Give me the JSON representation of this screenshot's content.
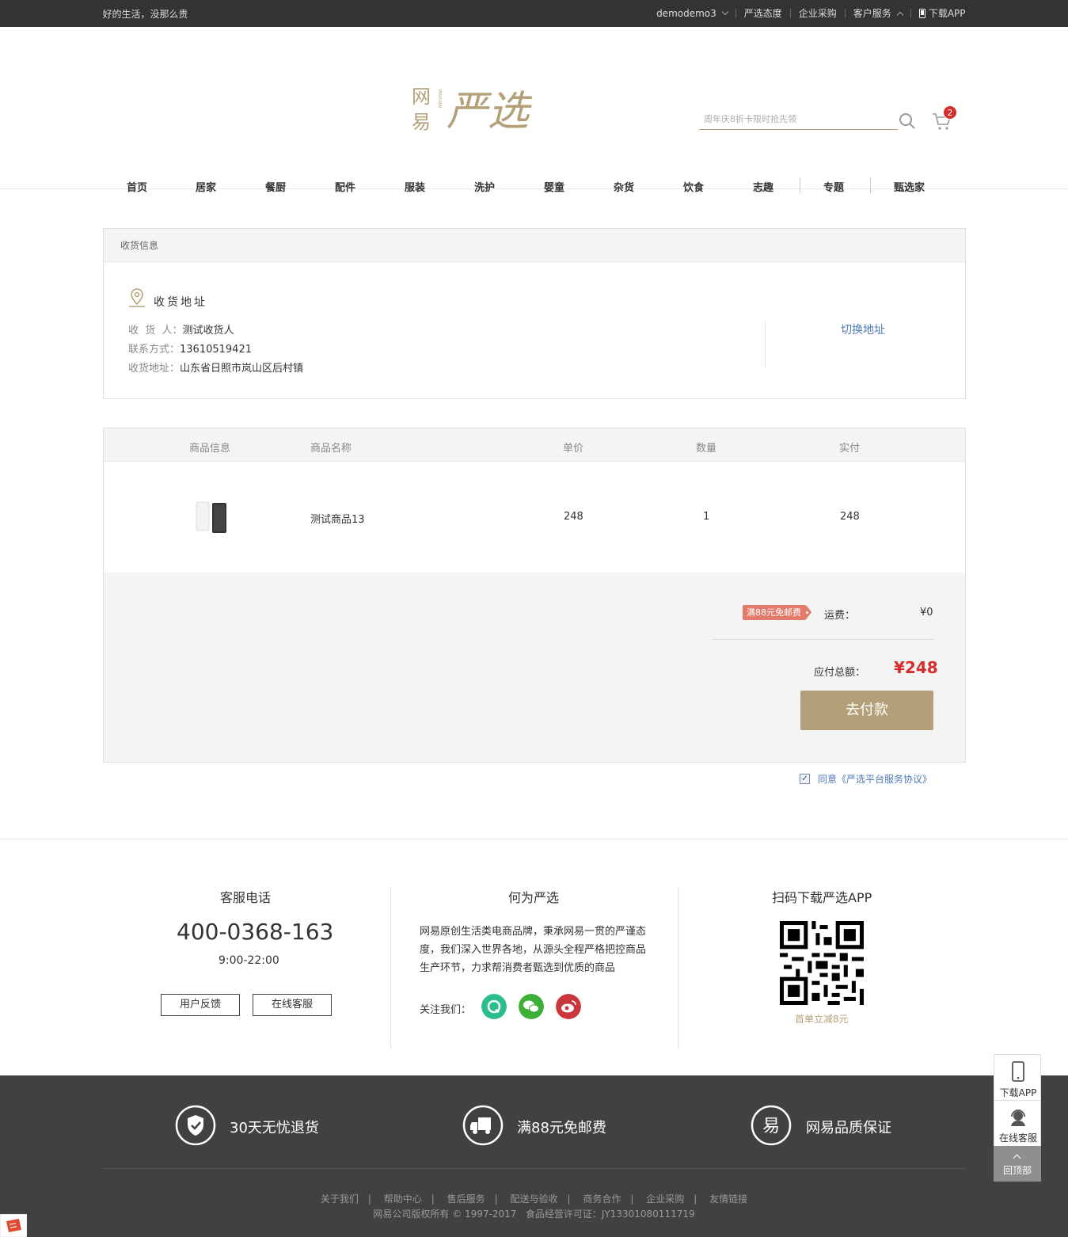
{
  "topbar": {
    "slogan": "好的生活，没那么贵",
    "user": "demodemo3",
    "links": [
      "严选态度",
      "企业采购",
      "客户服务"
    ],
    "app": "下载APP"
  },
  "header": {
    "search_placeholder": "周年庆8折卡限时抢先领",
    "cart_count": "2",
    "nav": [
      "首页",
      "居家",
      "餐厨",
      "配件",
      "服装",
      "洗护",
      "婴童",
      "杂货",
      "饮食",
      "志趣",
      "专题",
      "甄选家"
    ]
  },
  "address": {
    "panel_title": "收货信息",
    "section_title": "收货地址",
    "receiver_label": "收  货  人：",
    "receiver": "测试收货人",
    "phone_label": "联系方式：",
    "phone": "13610519421",
    "addr_label": "收货地址：",
    "addr": "山东省日照市岚山区后村镇",
    "switch": "切换地址"
  },
  "order": {
    "headers": [
      "商品信息",
      "商品名称",
      "单价",
      "数量",
      "实付"
    ],
    "item": {
      "name": "测试商品13",
      "price": "248",
      "qty": "1",
      "paid": "248"
    }
  },
  "summary": {
    "promo_tag": "满88元免邮费",
    "shipping_label": "运费：",
    "shipping": "¥0",
    "total_label": "应付总额：",
    "total": "¥248",
    "pay_button": "去付款",
    "agree": "同意《严选平台服务协议》"
  },
  "footer": {
    "service_title": "客服电话",
    "phone": "400-0368-163",
    "hours": "9:00-22:00",
    "feedback": "用户反馈",
    "online": "在线客服",
    "about_title": "何为严选",
    "about_text": [
      "网易原创生活类电商品牌，秉承网易一贯的严谨态",
      "度，我们深入世界各地，从源头全程严格把控商品",
      "生产环节，力求帮消费者甄选到优质的商品"
    ],
    "follow": "关注我们：",
    "qr_title": "扫码下载严选APP",
    "qr_note": "首单立减8元",
    "services": [
      "30天无忧退货",
      "满88元免邮费",
      "网易品质保证"
    ],
    "links": [
      "关于我们",
      "帮助中心",
      "售后服务",
      "配送与验收",
      "商务合作",
      "企业采购",
      "友情链接"
    ],
    "copyright": "网易公司版权所有 © 1997-2017   食品经营许可证：JY13301080111719"
  },
  "sidebar": {
    "app": "下载APP",
    "service": "在线客服",
    "top": "回顶部"
  },
  "colors": {
    "brand": "#b4a078",
    "price": "#d62c2c",
    "link": "#4e79b4",
    "footer_bg": "#414141"
  }
}
